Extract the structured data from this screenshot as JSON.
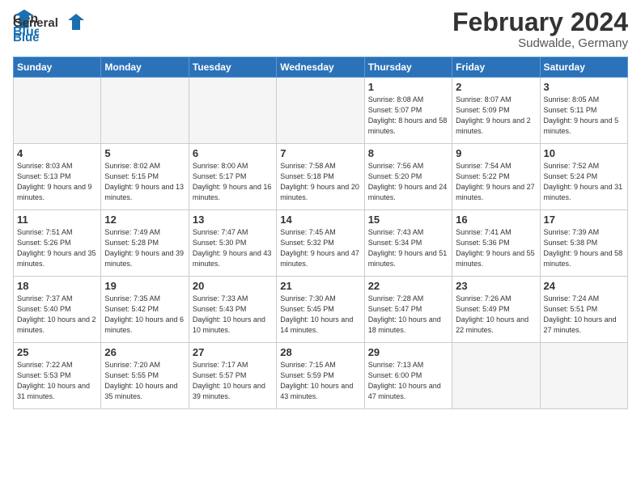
{
  "header": {
    "logo_line1": "General",
    "logo_line2": "Blue",
    "month": "February 2024",
    "location": "Sudwalde, Germany"
  },
  "weekdays": [
    "Sunday",
    "Monday",
    "Tuesday",
    "Wednesday",
    "Thursday",
    "Friday",
    "Saturday"
  ],
  "weeks": [
    [
      {
        "day": "",
        "empty": true
      },
      {
        "day": "",
        "empty": true
      },
      {
        "day": "",
        "empty": true
      },
      {
        "day": "",
        "empty": true
      },
      {
        "day": "1",
        "sunrise": "8:08 AM",
        "sunset": "5:07 PM",
        "daylight": "8 hours and 58 minutes."
      },
      {
        "day": "2",
        "sunrise": "8:07 AM",
        "sunset": "5:09 PM",
        "daylight": "9 hours and 2 minutes."
      },
      {
        "day": "3",
        "sunrise": "8:05 AM",
        "sunset": "5:11 PM",
        "daylight": "9 hours and 5 minutes."
      }
    ],
    [
      {
        "day": "4",
        "sunrise": "8:03 AM",
        "sunset": "5:13 PM",
        "daylight": "9 hours and 9 minutes."
      },
      {
        "day": "5",
        "sunrise": "8:02 AM",
        "sunset": "5:15 PM",
        "daylight": "9 hours and 13 minutes."
      },
      {
        "day": "6",
        "sunrise": "8:00 AM",
        "sunset": "5:17 PM",
        "daylight": "9 hours and 16 minutes."
      },
      {
        "day": "7",
        "sunrise": "7:58 AM",
        "sunset": "5:18 PM",
        "daylight": "9 hours and 20 minutes."
      },
      {
        "day": "8",
        "sunrise": "7:56 AM",
        "sunset": "5:20 PM",
        "daylight": "9 hours and 24 minutes."
      },
      {
        "day": "9",
        "sunrise": "7:54 AM",
        "sunset": "5:22 PM",
        "daylight": "9 hours and 27 minutes."
      },
      {
        "day": "10",
        "sunrise": "7:52 AM",
        "sunset": "5:24 PM",
        "daylight": "9 hours and 31 minutes."
      }
    ],
    [
      {
        "day": "11",
        "sunrise": "7:51 AM",
        "sunset": "5:26 PM",
        "daylight": "9 hours and 35 minutes."
      },
      {
        "day": "12",
        "sunrise": "7:49 AM",
        "sunset": "5:28 PM",
        "daylight": "9 hours and 39 minutes."
      },
      {
        "day": "13",
        "sunrise": "7:47 AM",
        "sunset": "5:30 PM",
        "daylight": "9 hours and 43 minutes."
      },
      {
        "day": "14",
        "sunrise": "7:45 AM",
        "sunset": "5:32 PM",
        "daylight": "9 hours and 47 minutes."
      },
      {
        "day": "15",
        "sunrise": "7:43 AM",
        "sunset": "5:34 PM",
        "daylight": "9 hours and 51 minutes."
      },
      {
        "day": "16",
        "sunrise": "7:41 AM",
        "sunset": "5:36 PM",
        "daylight": "9 hours and 55 minutes."
      },
      {
        "day": "17",
        "sunrise": "7:39 AM",
        "sunset": "5:38 PM",
        "daylight": "9 hours and 58 minutes."
      }
    ],
    [
      {
        "day": "18",
        "sunrise": "7:37 AM",
        "sunset": "5:40 PM",
        "daylight": "10 hours and 2 minutes."
      },
      {
        "day": "19",
        "sunrise": "7:35 AM",
        "sunset": "5:42 PM",
        "daylight": "10 hours and 6 minutes."
      },
      {
        "day": "20",
        "sunrise": "7:33 AM",
        "sunset": "5:43 PM",
        "daylight": "10 hours and 10 minutes."
      },
      {
        "day": "21",
        "sunrise": "7:30 AM",
        "sunset": "5:45 PM",
        "daylight": "10 hours and 14 minutes."
      },
      {
        "day": "22",
        "sunrise": "7:28 AM",
        "sunset": "5:47 PM",
        "daylight": "10 hours and 18 minutes."
      },
      {
        "day": "23",
        "sunrise": "7:26 AM",
        "sunset": "5:49 PM",
        "daylight": "10 hours and 22 minutes."
      },
      {
        "day": "24",
        "sunrise": "7:24 AM",
        "sunset": "5:51 PM",
        "daylight": "10 hours and 27 minutes."
      }
    ],
    [
      {
        "day": "25",
        "sunrise": "7:22 AM",
        "sunset": "5:53 PM",
        "daylight": "10 hours and 31 minutes."
      },
      {
        "day": "26",
        "sunrise": "7:20 AM",
        "sunset": "5:55 PM",
        "daylight": "10 hours and 35 minutes."
      },
      {
        "day": "27",
        "sunrise": "7:17 AM",
        "sunset": "5:57 PM",
        "daylight": "10 hours and 39 minutes."
      },
      {
        "day": "28",
        "sunrise": "7:15 AM",
        "sunset": "5:59 PM",
        "daylight": "10 hours and 43 minutes."
      },
      {
        "day": "29",
        "sunrise": "7:13 AM",
        "sunset": "6:00 PM",
        "daylight": "10 hours and 47 minutes."
      },
      {
        "day": "",
        "empty": true
      },
      {
        "day": "",
        "empty": true
      }
    ]
  ]
}
